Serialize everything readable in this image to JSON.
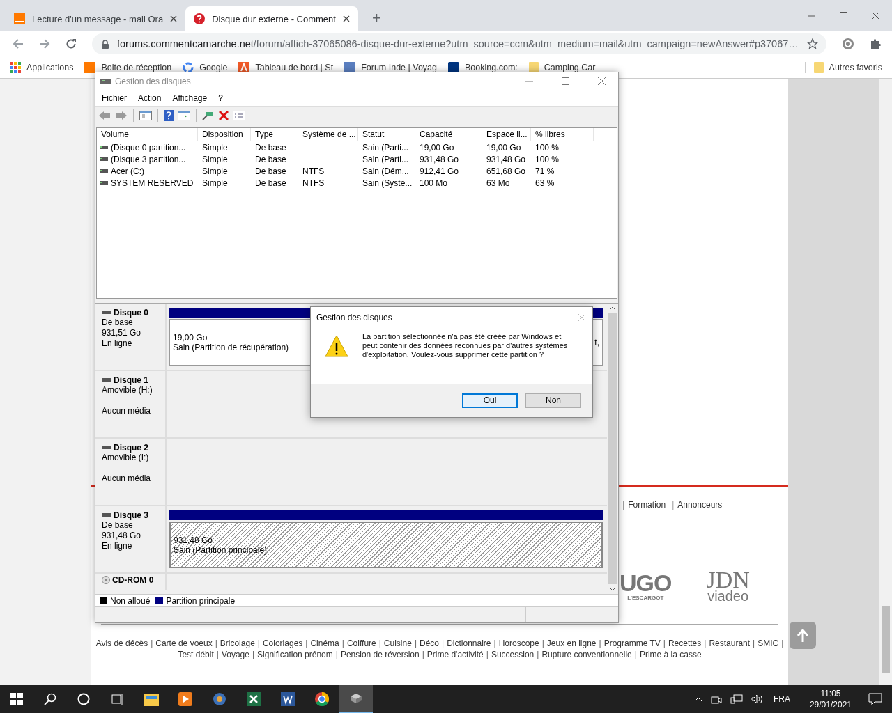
{
  "browser": {
    "tabs": [
      {
        "title": "Lecture d'un message - mail Ora",
        "kind": "orange",
        "selected": false
      },
      {
        "title": "Disque dur externe - Comment",
        "kind": "ccm",
        "selected": true
      }
    ],
    "new_tab": "+",
    "address": {
      "host": "forums.commentcamarche.net",
      "path": "/forum/affich-37065086-disque-dur-externe?utm_source=ccm&utm_medium=mail&utm_campaign=newAnswer#p37067…"
    },
    "bookmarks": [
      {
        "label": "Applications",
        "kind": "apps"
      },
      {
        "label": "Boite de réception",
        "kind": "orange"
      },
      {
        "label": "Google",
        "kind": "google"
      },
      {
        "label": "Tableau de bord | St",
        "kind": "tableau"
      },
      {
        "label": "Forum Inde | Voyag",
        "kind": "forum"
      },
      {
        "label": "Booking.com:",
        "kind": "booking"
      },
      {
        "label": "Camping Car",
        "kind": "folder"
      }
    ],
    "other_bookmarks": "Autres favoris"
  },
  "page": {
    "separator": "|",
    "top_links": [
      "Formation",
      "Annonceurs"
    ],
    "logos": [
      {
        "kind": "ugo",
        "name": "UGO",
        "tagline": "L'ESCARGOT"
      },
      {
        "kind": "jdn",
        "name": "JDN",
        "tagline": "viadeo"
      }
    ],
    "footer_lines": [
      {
        "links": [
          "Avis de décès",
          "Carte de voeux",
          "Bricolage",
          "Coloriages",
          "Cinéma",
          "Coiffure",
          "Cuisine",
          "Déco",
          "Dictionnaire",
          "Horoscope",
          "Jeux en ligne",
          "Programme TV",
          "Recettes",
          "Restaurant",
          "SMIC"
        ],
        "trailing_separator": true
      },
      {
        "links": [
          "Test débit",
          "Voyage",
          "Signification prénom",
          "Pension de réversion",
          "Prime d'activité",
          "Succession",
          "Rupture conventionnelle",
          "Prime à la casse"
        ],
        "trailing_separator": false
      }
    ]
  },
  "disk_manager": {
    "title": "Gestion des disques",
    "menu": [
      "Fichier",
      "Action",
      "Affichage",
      "?"
    ],
    "toolbar": [
      {
        "kind": "back"
      },
      {
        "kind": "forward"
      },
      {
        "kind": "sep"
      },
      {
        "kind": "tree"
      },
      {
        "kind": "sep"
      },
      {
        "kind": "help"
      },
      {
        "kind": "pane"
      },
      {
        "kind": "sep"
      },
      {
        "kind": "connect"
      },
      {
        "kind": "delete"
      },
      {
        "kind": "properties"
      }
    ],
    "columns": [
      "Volume",
      "Disposition",
      "Type",
      "Système de ...",
      "Statut",
      "Capacité",
      "Espace li...",
      "% libres"
    ],
    "rows": [
      [
        "(Disque 0 partition...",
        "Simple",
        "De base",
        "",
        "Sain (Parti...",
        "19,00 Go",
        "19,00 Go",
        "100 %"
      ],
      [
        "(Disque 3 partition...",
        "Simple",
        "De base",
        "",
        "Sain (Parti...",
        "931,48 Go",
        "931,48 Go",
        "100 %"
      ],
      [
        "Acer (C:)",
        "Simple",
        "De base",
        "NTFS",
        "Sain (Dém...",
        "912,41 Go",
        "651,68 Go",
        "71 %"
      ],
      [
        "SYSTEM RESERVED",
        "Simple",
        "De base",
        "NTFS",
        "Sain (Systè...",
        "100 Mo",
        "63 Mo",
        "63 %"
      ]
    ],
    "disks": [
      {
        "name": "Disque 0",
        "kind": "disk",
        "type": "De base",
        "size": "931,51 Go",
        "status": "En ligne",
        "partitions": [
          {
            "size": "19,00 Go",
            "status": "Sain (Partition de récupération)",
            "selected": false
          },
          {
            "status": "t,",
            "selected": false
          }
        ]
      },
      {
        "name": "Disque 1",
        "kind": "disk",
        "type": "Amovible (H:)",
        "status": "Aucun média"
      },
      {
        "name": "Disque 2",
        "kind": "disk",
        "type": "Amovible (I:)",
        "status": "Aucun média"
      },
      {
        "name": "Disque 3",
        "kind": "disk",
        "type": "De base",
        "size": "931,48 Go",
        "status": "En ligne",
        "partitions": [
          {
            "size": "931,48 Go",
            "status": "Sain (Partition principale)",
            "selected": true
          }
        ]
      },
      {
        "name": "CD-ROM 0",
        "kind": "cdrom"
      }
    ],
    "legend": [
      {
        "label": "Non alloué",
        "color": "#000000"
      },
      {
        "label": "Partition principale",
        "color": "#000080"
      }
    ]
  },
  "dialog": {
    "title": "Gestion des disques",
    "message": "La partition sélectionnée n'a pas été créée par Windows et peut contenir des données reconnues par d'autres systèmes d'exploitation. Voulez-vous supprimer cette partition ?",
    "buttons": [
      {
        "label": "Oui",
        "focused": true
      },
      {
        "label": "Non",
        "focused": false
      }
    ]
  },
  "taskbar": {
    "apps": [
      {
        "kind": "explorer",
        "active": false
      },
      {
        "kind": "media",
        "active": false
      },
      {
        "kind": "photo",
        "active": false
      },
      {
        "kind": "excel",
        "active": false
      },
      {
        "kind": "word",
        "active": false
      },
      {
        "kind": "chrome",
        "active": false
      },
      {
        "kind": "disks",
        "active": true
      }
    ],
    "language": "FRA",
    "time": "11:05",
    "date": "29/01/2021"
  }
}
